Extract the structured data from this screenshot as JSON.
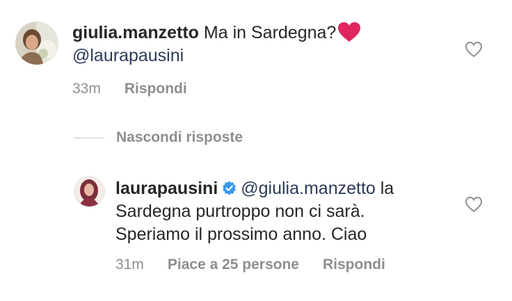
{
  "comment": {
    "username": "giulia.manzetto",
    "text_before": "Ma in Sardegna?",
    "emoji": "red-heart-emoji",
    "mention": "@laurapausini",
    "time": "33m",
    "reply_label": "Rispondi"
  },
  "hide_replies_label": "Nascondi risposte",
  "reply": {
    "username": "laurapausini",
    "mention": "@giulia.manzetto",
    "text_line1_tail": " la",
    "text_line2": "Sardegna purtroppo non ci sarà.",
    "text_line3": "Speriamo il prossimo anno. Ciao",
    "time": "31m",
    "likes_label": "Piace a 25 persone",
    "reply_label": "Rispondi"
  },
  "colors": {
    "text": "#262626",
    "muted": "#8e8e8e",
    "mention": "#2b3a59",
    "verified": "#3897f0",
    "heart_emoji": "#e0245e"
  }
}
